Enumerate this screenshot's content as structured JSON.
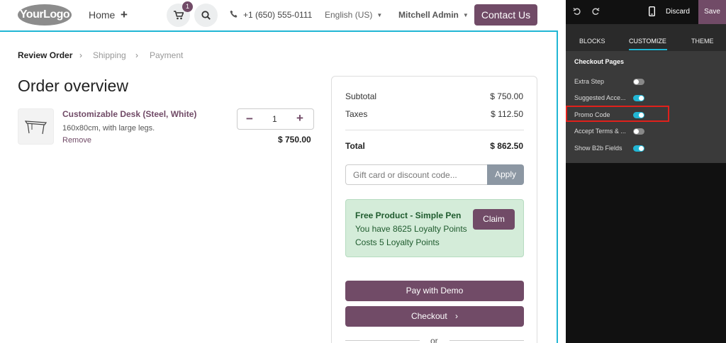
{
  "header": {
    "logo": "YourLogo",
    "home_label": "Home",
    "cart_count": "1",
    "phone": "+1 (650) 555-0111",
    "language": "English (US)",
    "user": "Mitchell Admin",
    "contact_label": "Contact Us"
  },
  "breadcrumb": {
    "active": "Review Order",
    "step2": "Shipping",
    "step3": "Payment"
  },
  "order": {
    "title": "Order overview",
    "product_name": "Customizable Desk (Steel, White)",
    "product_desc": "160x80cm, with large legs.",
    "remove_label": "Remove",
    "quantity": "1",
    "line_price": "$ 750.00"
  },
  "summary": {
    "subtotal_label": "Subtotal",
    "subtotal_value": "$ 750.00",
    "taxes_label": "Taxes",
    "taxes_value": "$ 112.50",
    "total_label": "Total",
    "total_value": "$ 862.50",
    "promo_placeholder": "Gift card or discount code...",
    "apply_label": "Apply",
    "reward": {
      "title": "Free Product - Simple Pen",
      "line1": "You have 8625 Loyalty Points",
      "line2": "Costs 5 Loyalty Points",
      "claim_label": "Claim"
    },
    "pay_label": "Pay with Demo",
    "checkout_label": "Checkout",
    "or_label": "or"
  },
  "editor": {
    "discard_label": "Discard",
    "save_label": "Save",
    "tabs": [
      "BLOCKS",
      "CUSTOMIZE",
      "THEME"
    ],
    "active_tab": "CUSTOMIZE",
    "section_title": "Checkout Pages",
    "options": [
      {
        "label": "Extra Step",
        "enabled": false
      },
      {
        "label": "Suggested Acce...",
        "enabled": true
      },
      {
        "label": "Promo Code",
        "enabled": true
      },
      {
        "label": "Accept Terms & ...",
        "enabled": false
      },
      {
        "label": "Show B2b Fields",
        "enabled": true
      }
    ],
    "highlighted_option": "Promo Code"
  },
  "colors": {
    "brand": "#714b67",
    "accent": "#21b6d4",
    "highlight": "#e0201b",
    "reward_bg": "#d4ecd9"
  }
}
